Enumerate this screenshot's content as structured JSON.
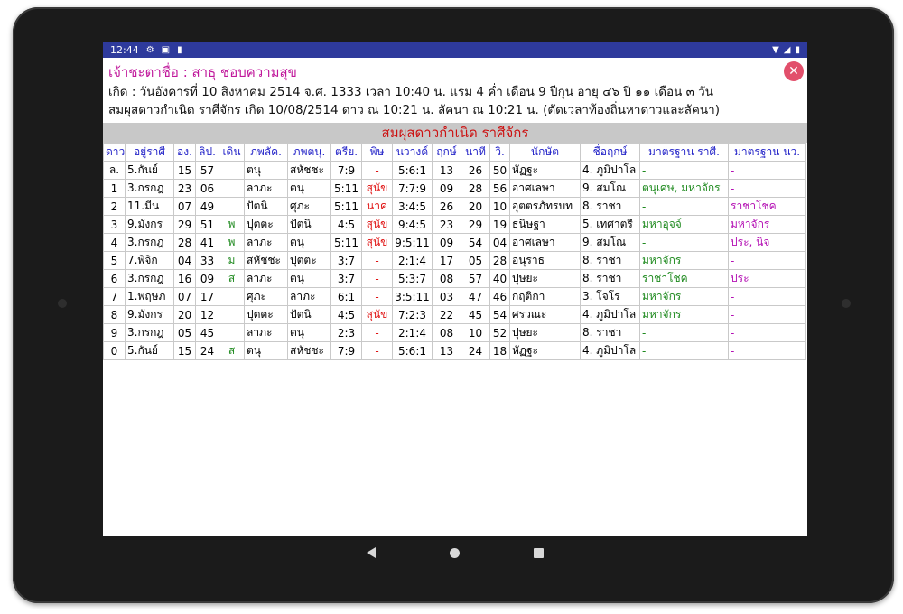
{
  "status": {
    "time": "12:44"
  },
  "header": {
    "owner": "เจ้าชะตาชื่อ : สาธุ ชอบความสุข",
    "birth": "เกิด : วันอังคารที่ 10 สิงหาคม 2514 จ.ศ. 1333 เวลา 10:40 น.  แรม 4 ค่ำ เดือน 9 ปีกุน   อายุ ๔๖ ปี ๑๑ เดือน ๓ วัน",
    "horoscope": "สมผุสดาวกำเนิด ราศีจักร  เกิด 10/08/2514 ดาว ณ 10:21 น. ลัคนา ณ 10:21 น. (ตัดเวลาท้องถิ่นหาดาวและลัคนา)",
    "close_label": "✕"
  },
  "section_title": "สมผุสดาวกำเนิด ราศีจักร",
  "table": {
    "columns": [
      "ดาว",
      "อยู่ราศี",
      "อง.",
      "ลิป.",
      "เดิน",
      "ภพลัค.",
      "ภพตนุ.",
      "ตรีย.",
      "พิษ",
      "นวางค์",
      "ฤกษ์",
      "นาที",
      "วิ.",
      "นักษัต",
      "ชื่อฤกษ์",
      "มาตรฐาน ราศี.",
      "มาตรฐาน นว."
    ],
    "rows": [
      [
        "ล.",
        "5.กันย์",
        "15",
        "57",
        "",
        "ตนุ",
        "สหัชชะ",
        "7:9",
        "-",
        "5:6:1",
        "13",
        "26",
        "50",
        "หัฏฐะ",
        "4. ภูมิปาโล",
        "-",
        "-"
      ],
      [
        "1",
        "3.กรกฎ",
        "23",
        "06",
        "",
        "ลาภะ",
        "ตนุ",
        "5:11",
        "สุนัข",
        "7:7:9",
        "09",
        "28",
        "56",
        "อาศเลษา",
        "9. สมโณ",
        "ตนุเศษ, มหาจักร",
        "-"
      ],
      [
        "2",
        "11.มีน",
        "07",
        "49",
        "",
        "ปัตนิ",
        "ศุภะ",
        "5:11",
        "นาค",
        "3:4:5",
        "26",
        "20",
        "10",
        "อุตตรภัทรบท",
        "8. ราชา",
        "-",
        "ราชาโชค"
      ],
      [
        "3",
        "9.มังกร",
        "29",
        "51",
        "พ",
        "ปุตตะ",
        "ปัตนิ",
        "4:5",
        "สุนัข",
        "9:4:5",
        "23",
        "29",
        "19",
        "ธนิษฐา",
        "5. เทศาตรี",
        "มหาอุจจ์",
        "มหาจักร"
      ],
      [
        "4",
        "3.กรกฎ",
        "28",
        "41",
        "พ",
        "ลาภะ",
        "ตนุ",
        "5:11",
        "สุนัข",
        "9:5:11",
        "09",
        "54",
        "04",
        "อาศเลษา",
        "9. สมโณ",
        "-",
        "ประ, นิจ"
      ],
      [
        "5",
        "7.พิจิก",
        "04",
        "33",
        "ม",
        "สหัชชะ",
        "ปุตตะ",
        "3:7",
        "-",
        "2:1:4",
        "17",
        "05",
        "28",
        "อนุราธ",
        "8. ราชา",
        "มหาจักร",
        "-"
      ],
      [
        "6",
        "3.กรกฎ",
        "16",
        "09",
        "ส",
        "ลาภะ",
        "ตนุ",
        "3:7",
        "-",
        "5:3:7",
        "08",
        "57",
        "40",
        "ปุษยะ",
        "8. ราชา",
        "ราชาโชค",
        "ประ"
      ],
      [
        "7",
        "1.พฤษภ",
        "07",
        "17",
        "",
        "ศุภะ",
        "ลาภะ",
        "6:1",
        "-",
        "3:5:11",
        "03",
        "47",
        "46",
        "กฤติกา",
        "3. โจโร",
        "มหาจักร",
        "-"
      ],
      [
        "8",
        "9.มังกร",
        "20",
        "12",
        "",
        "ปุตตะ",
        "ปัตนิ",
        "4:5",
        "สุนัข",
        "7:2:3",
        "22",
        "45",
        "54",
        "ศรวณะ",
        "4. ภูมิปาโล",
        "มหาจักร",
        "-"
      ],
      [
        "9",
        "3.กรกฎ",
        "05",
        "45",
        "",
        "ลาภะ",
        "ตนุ",
        "2:3",
        "-",
        "2:1:4",
        "08",
        "10",
        "52",
        "ปุษยะ",
        "8. ราชา",
        "-",
        "-"
      ],
      [
        "0",
        "5.กันย์",
        "15",
        "24",
        "ส",
        "ตนุ",
        "สหัชชะ",
        "7:9",
        "-",
        "5:6:1",
        "13",
        "24",
        "18",
        "หัฏฐะ",
        "4. ภูมิปาโล",
        "-",
        "-"
      ]
    ]
  },
  "colors": {
    "title": "#c0189b",
    "header_text": "#2424c8",
    "section_title": "#cc1111",
    "green": "#1f8a1f",
    "red": "#e01010",
    "purple": "#b410b4",
    "statusbar": "#2e3a9c"
  }
}
